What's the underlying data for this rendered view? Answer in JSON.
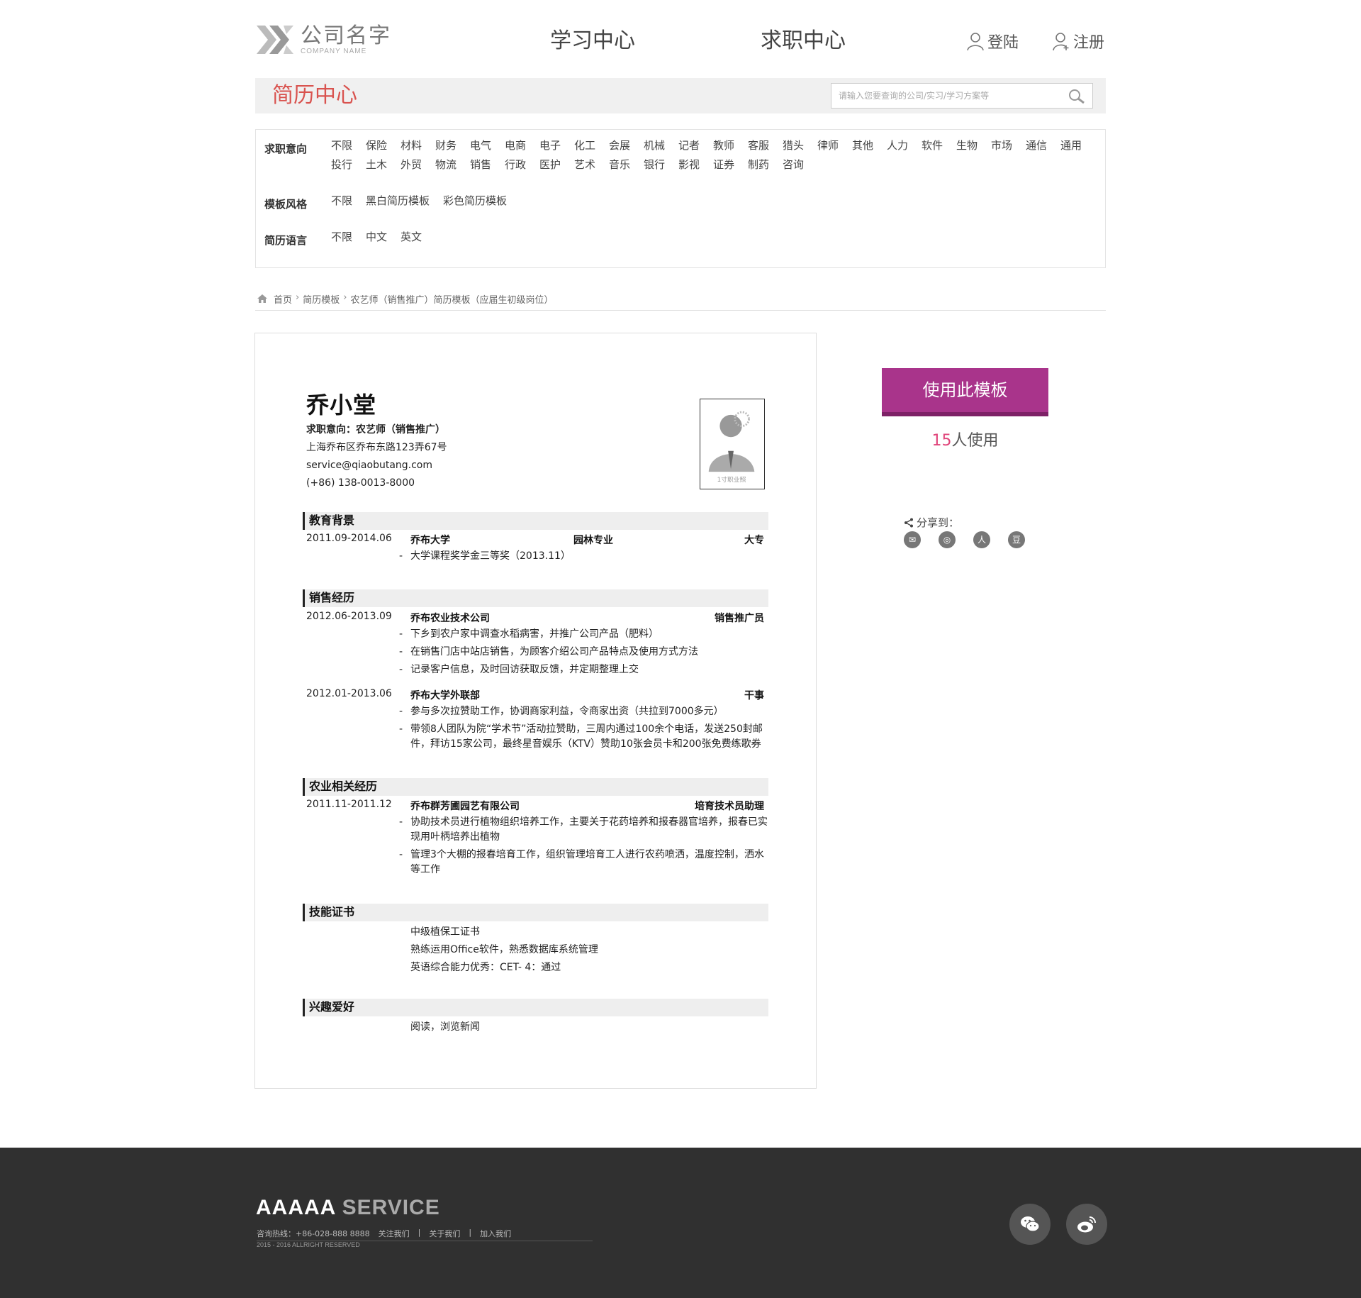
{
  "header": {
    "logo_name": "公司名字",
    "logo_sub": "COMPANY NAME",
    "nav": [
      "学习中心",
      "求职中心"
    ],
    "login": "登陆",
    "register": "注册"
  },
  "titlebar": {
    "title": "简历中心",
    "search_placeholder": "请输入您要查询的公司/实习/学习方案等"
  },
  "filter": {
    "intent_label": "求职意向",
    "intent_options": [
      "不限",
      "保险",
      "材料",
      "财务",
      "电气",
      "电商",
      "电子",
      "化工",
      "会展",
      "机械",
      "记者",
      "教师",
      "客服",
      "猎头",
      "律师",
      "其他",
      "人力",
      "软件",
      "生物",
      "市场",
      "通信",
      "通用",
      "投行",
      "土木",
      "外贸",
      "物流",
      "销售",
      "行政",
      "医护",
      "艺术",
      "音乐",
      "银行",
      "影视",
      "证券",
      "制药",
      "咨询"
    ],
    "style_label": "模板风格",
    "style_options": [
      "不限",
      "黑白简历模板",
      "彩色简历模板"
    ],
    "lang_label": "简历语言",
    "lang_options": [
      "不限",
      "中文",
      "英文"
    ]
  },
  "breadcrumb": [
    "首页",
    "简历模板",
    "农艺师（销售推广）简历模板（应届生初级岗位）"
  ],
  "resume": {
    "name": "乔小堂",
    "intent": "求职意向：农艺师（销售推广）",
    "address": "上海乔布区乔布东路123弄67号",
    "email": "service@qiaobutang.com",
    "phone": "(+86) 138-0013-8000",
    "photo_label": "1寸职业照",
    "edu": {
      "title": "教育背景",
      "date": "2011.09-2014.06",
      "school": "乔布大学",
      "major": "园林专业",
      "degree": "大专",
      "items": [
        "大学课程奖学金三等奖（2013.11）"
      ]
    },
    "sales": {
      "title": "销售经历",
      "jobs": [
        {
          "date": "2012.06-2013.09",
          "org": "乔布农业技术公司",
          "role": "销售推广员",
          "items": [
            "下乡到农户家中调查水稻病害，并推广公司产品（肥料）",
            "在销售门店中站店销售，为顾客介绍公司产品特点及使用方式方法",
            "记录客户信息，及时回访获取反馈，并定期整理上交"
          ]
        },
        {
          "date": "2012.01-2013.06",
          "org": "乔布大学外联部",
          "role": "干事",
          "items": [
            "参与多次拉赞助工作，协调商家利益，令商家出资（共拉到7000多元）",
            "带领8人团队为院“学术节”活动拉赞助，三周内通过100余个电话，发送250封邮件，拜访15家公司，最终星音娱乐（KTV）赞助10张会员卡和200张免费练歌券"
          ]
        }
      ]
    },
    "agri": {
      "title": "农业相关经历",
      "date": "2011.11-2011.12",
      "org": "乔布群芳圃园艺有限公司",
      "role": "培育技术员助理",
      "items": [
        "协助技术员进行植物组织培养工作，主要关于花药培养和报春器官培养，报春已实现用叶柄培养出植物",
        "管理3个大棚的报春培育工作，组织管理培育工人进行农药喷洒，温度控制，洒水等工作"
      ]
    },
    "skills": {
      "title": "技能证书",
      "items": [
        "中级植保工证书",
        "熟练运用Office软件，熟悉数据库系统管理",
        "英语综合能力优秀：CET- 4：通过"
      ]
    },
    "hobby": {
      "title": "兴趣爱好",
      "items": [
        "阅读，浏览新闻"
      ]
    }
  },
  "side": {
    "use_button": "使用此模板",
    "use_count": "15",
    "use_suffix": "人使用",
    "share_label": "分享到："
  },
  "footer": {
    "brand_main": "AAAAA",
    "brand_service": "SERVICE",
    "hotline": "咨询热线：+86-028-888 8888",
    "link1": "关注我们",
    "link2": "关于我们",
    "link3": "加入我们",
    "copyright": "2015 - 2016 ALLRIGHT RESERVED"
  },
  "colors": {
    "accent_red": "#d9534f",
    "button": "#a9348b",
    "count": "#e0447a",
    "footer_bg": "#303030"
  }
}
